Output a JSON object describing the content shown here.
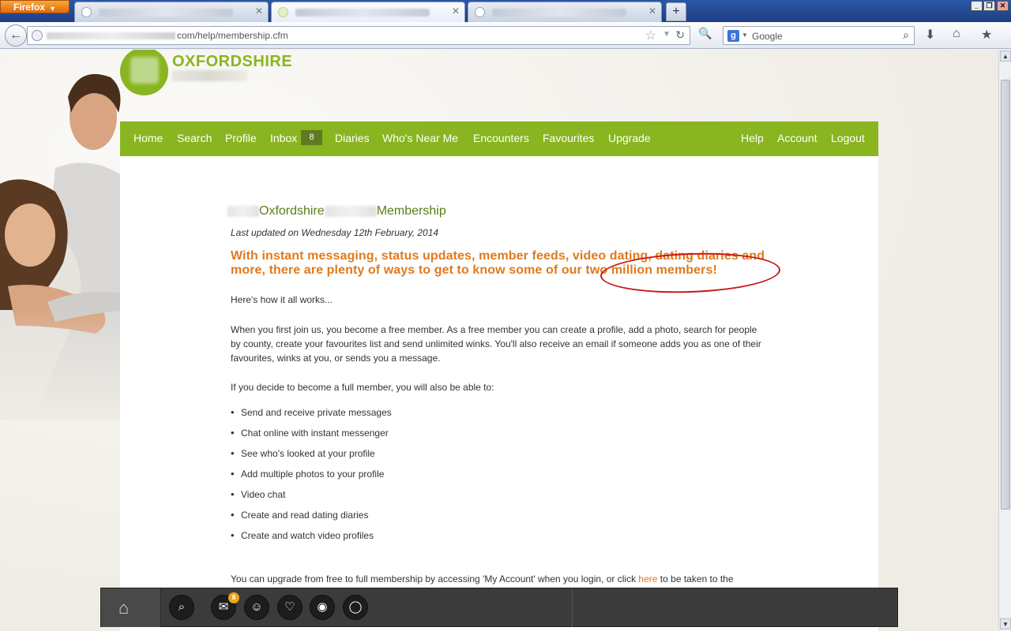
{
  "browser": {
    "app_button": "Firefox",
    "url_visible": "com/help/membership.cfm",
    "search_placeholder": "Google",
    "new_tab": "+"
  },
  "site": {
    "logo_title": "OXFORDSHIRE",
    "nav": {
      "items": [
        "Home",
        "Search",
        "Profile",
        "Inbox",
        "Diaries",
        "Who's Near Me",
        "Encounters",
        "Favourites",
        "Upgrade"
      ],
      "right_items": [
        "Help",
        "Account",
        "Logout"
      ],
      "inbox_count": "8"
    }
  },
  "content": {
    "title_part1": "Oxfordshire",
    "title_part2": "Membership",
    "updated": "Last updated on Wednesday 12th February, 2014",
    "headline": "With instant messaging, status updates, member feeds, video dating, dating diaries and more, there are plenty of ways to get to know some of our two million members!",
    "intro": "Here's how it all works...",
    "p1": "When you first join us, you become a free member. As a free member you can create a profile, add a photo, search for people by county, create your favourites list and send unlimited winks. You'll also receive an email if someone adds you as one of their favourites, winks at you, or sends you a message.",
    "p2": "If you decide to become a full member, you will also be able to:",
    "bullets": [
      "Send and receive private messages",
      "Chat online with instant messenger",
      "See who's looked at your profile",
      "Add multiple photos to your profile",
      "Video chat",
      "Create and read dating diaries",
      "Create and watch video profiles"
    ],
    "p3_before": "You can upgrade from free to full membership by accessing 'My Account' when you login, or click",
    "p3_link": "here",
    "p3_after": "to be taken to the"
  },
  "dock": {
    "mail_badge": "8"
  },
  "colors": {
    "brand_green": "#88b520",
    "accent_orange": "#e07a1c",
    "annotation_red": "#c81717"
  }
}
